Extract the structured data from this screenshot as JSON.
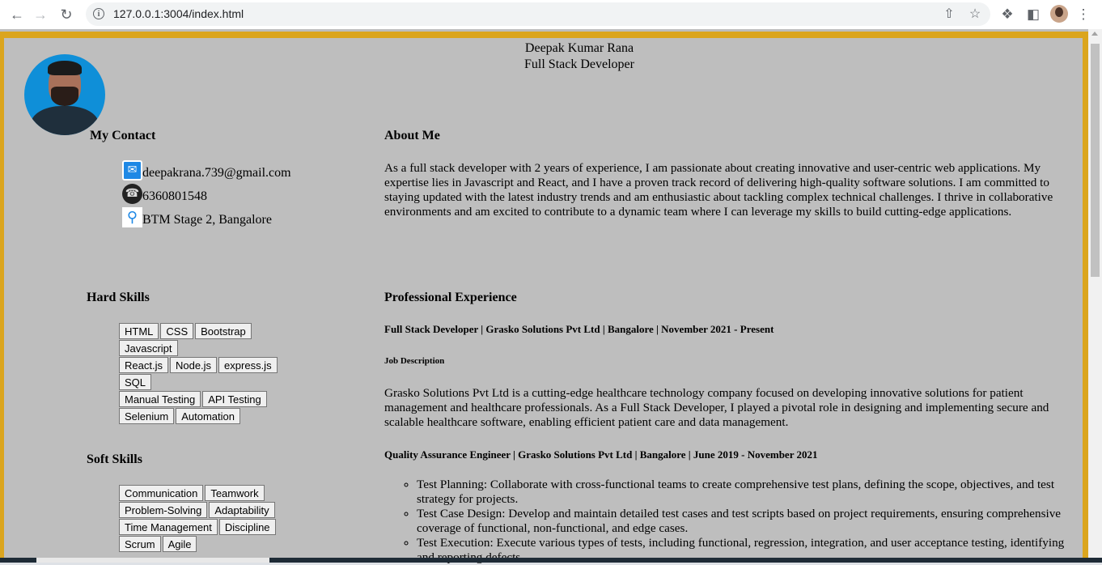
{
  "browser": {
    "url": "127.0.0.1:3004/index.html"
  },
  "header": {
    "name": "Deepak Kumar Rana",
    "role": "Full Stack Developer"
  },
  "contact": {
    "title": "My Contact",
    "email": "deepakrana.739@gmail.com",
    "phone": "6360801548",
    "location": "BTM Stage 2, Bangalore"
  },
  "about": {
    "title": "About Me",
    "text": "As a full stack developer with 2 years of experience, I am passionate about creating innovative and user-centric web applications. My expertise lies in Javascript and React, and I have a proven track record of delivering high-quality software solutions. I am committed to staying updated with the latest industry trends and am enthusiastic about tackling complex technical challenges. I thrive in collaborative environments and am excited to contribute to a dynamic team where I can leverage my skills to build cutting-edge applications."
  },
  "hard_skills": {
    "title": "Hard Skills",
    "rows": [
      [
        "HTML",
        "CSS",
        "Bootstrap"
      ],
      [
        "Javascript"
      ],
      [
        "React.js",
        "Node.js",
        "express.js"
      ],
      [
        "SQL"
      ],
      [
        "Manual Testing",
        "API Testing"
      ],
      [
        "Selenium",
        "Automation"
      ]
    ]
  },
  "soft_skills": {
    "title": "Soft Skills",
    "rows": [
      [
        "Communication",
        "Teamwork"
      ],
      [
        "Problem-Solving",
        "Adaptability"
      ],
      [
        "Time Management",
        "Discipline"
      ],
      [
        "Scrum",
        "Agile"
      ]
    ]
  },
  "experience": {
    "title": "Professional Experience",
    "job1_title": "Full Stack Developer | Grasko Solutions Pvt Ltd | Bangalore | November 2021 - Present",
    "job1_desc_label": "Job Description",
    "job1_desc": "Grasko Solutions Pvt Ltd is a cutting-edge healthcare technology company focused on developing innovative solutions for patient management and healthcare professionals. As a Full Stack Developer, I played a pivotal role in designing and implementing secure and scalable healthcare software, enabling efficient patient care and data management.",
    "job2_title": "Quality Assurance Engineer | Grasko Solutions Pvt Ltd | Bangalore | June 2019 - November 2021",
    "job2_tasks": [
      "Test Planning: Collaborate with cross-functional teams to create comprehensive test plans, defining the scope, objectives, and test strategy for projects.",
      "Test Case Design: Develop and maintain detailed test cases and test scripts based on project requirements, ensuring comprehensive coverage of functional, non-functional, and edge cases.",
      "Test Execution: Execute various types of tests, including functional, regression, integration, and user acceptance testing, identifying and reporting defects."
    ]
  }
}
